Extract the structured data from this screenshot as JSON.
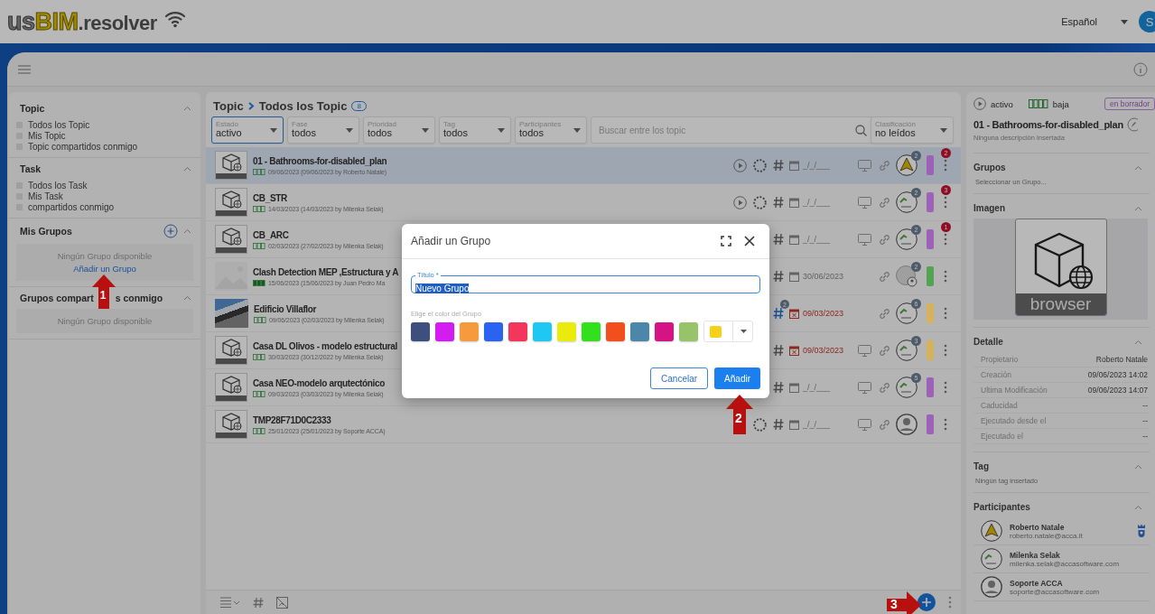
{
  "app": {
    "logo": {
      "prefix": "us",
      "highlight": "BIM",
      "suffix": ".resolver"
    },
    "language": "Español",
    "user_initial": "S"
  },
  "sidebar": {
    "sections": [
      {
        "kind": "list",
        "title": "Topic",
        "items": [
          "Todos los Topic",
          "Mis Topic",
          "Topic compartidos conmigo"
        ]
      },
      {
        "kind": "list",
        "title": "Task",
        "items": [
          "Todos los Task",
          "Mis Task",
          "compartidos conmigo"
        ]
      },
      {
        "kind": "groups",
        "title": "Mis Grupos",
        "empty": "Ningún Grupo disponible",
        "link": "Añadir un Grupo"
      },
      {
        "kind": "shared",
        "title": "Grupos compart",
        "title_end": "s conmigo",
        "empty": "Ningún Grupo disponible"
      }
    ]
  },
  "topics": {
    "breadcrumb": [
      "Topic",
      "Todos los Topic"
    ],
    "count": "8",
    "filters": [
      {
        "label": "Estado",
        "value": "activo",
        "selected": true
      },
      {
        "label": "Fase",
        "value": "todos",
        "selected": false
      },
      {
        "label": "Prioridad",
        "value": "todos",
        "selected": false
      },
      {
        "label": "Tag",
        "value": "todos",
        "selected": false
      },
      {
        "label": "Participantes",
        "value": "todos",
        "selected": false
      }
    ],
    "search": {
      "placeholder": "Buscar entre los topic"
    },
    "sort": {
      "label": "Clasificación",
      "value": "no leídos"
    },
    "rows": [
      {
        "title": "01 - Bathrooms-for-disabled_plan",
        "meta": "09/06/2023 (09/06/2023 by Roberto Natale)",
        "thumb": {
          "kind": "model"
        },
        "high_priority": false,
        "selected": true,
        "play": true,
        "spinner": true,
        "date": "_/_/___",
        "overdue": false,
        "monitor": true,
        "avatar": {
          "kind": "acca",
          "count": "2"
        },
        "color": "#9b62b8",
        "notifications": "2"
      },
      {
        "title": "CB_STR",
        "meta": "14/03/2023 (14/03/2023 by Milenka Selak)",
        "thumb": {
          "kind": "model"
        },
        "high_priority": false,
        "selected": false,
        "play": true,
        "spinner": true,
        "date": "_/_/___",
        "overdue": false,
        "monitor": true,
        "avatar": {
          "kind": "user",
          "count": "2"
        },
        "color": "#9b62b8",
        "notifications": "3"
      },
      {
        "title": "CB_ARC",
        "meta": "02/03/2023 (27/02/2023 by Milenka Selak)",
        "thumb": {
          "kind": "model"
        },
        "high_priority": false,
        "selected": false,
        "play": false,
        "spinner": false,
        "date": "_/_/___",
        "overdue": false,
        "monitor": true,
        "avatar": {
          "kind": "user",
          "count": "2"
        },
        "color": "#9b62b8",
        "notifications": "1"
      },
      {
        "title": "Clash Detection MEP ,Estructura y A",
        "meta": "15/06/2023 (15/06/2023 by Juan Pedro Ma",
        "thumb": {
          "kind": "blank"
        },
        "high_priority": true,
        "selected": false,
        "play": false,
        "spinner": false,
        "date": "30/06/2023",
        "overdue": false,
        "monitor": false,
        "avatar": {
          "kind": "blank",
          "count": "2"
        },
        "color": "#52a352"
      },
      {
        "title": "Edificio Villaflor",
        "meta": "09/06/2023 (02/03/2023 by Milenka Selak)",
        "thumb": {
          "kind": "photo"
        },
        "high_priority": false,
        "selected": false,
        "play": false,
        "spinner": false,
        "tag_count": "2",
        "date": "09/03/2023",
        "overdue": true,
        "monitor": false,
        "avatar": {
          "kind": "user",
          "count": "6"
        },
        "color": "#d4b35c"
      },
      {
        "title": "Casa DL Olivos - modelo estructural",
        "meta": "30/03/2023 (30/12/2022 by Milenka Selak)",
        "thumb": {
          "kind": "model"
        },
        "high_priority": false,
        "selected": false,
        "play": false,
        "spinner": false,
        "date": "09/03/2023",
        "overdue": true,
        "monitor": true,
        "avatar": {
          "kind": "user",
          "count": "3"
        },
        "color": "#d4b35c"
      },
      {
        "title": "Casa NEO-modelo arqutectónico",
        "meta": "09/03/2023 (03/03/2023 by Milenka Selak)",
        "thumb": {
          "kind": "model"
        },
        "high_priority": false,
        "selected": false,
        "play": false,
        "spinner": false,
        "date": "_/_/___",
        "overdue": false,
        "monitor": true,
        "avatar": {
          "kind": "user",
          "count": "5"
        },
        "color": "#9b62b8"
      },
      {
        "title": "TMP28F71D0C2333",
        "meta": "25/01/2023 (25/01/2023 by Soporte ACCA)",
        "thumb": {
          "kind": "model"
        },
        "high_priority": false,
        "selected": false,
        "play": false,
        "spinner": true,
        "date": "_/_/___",
        "overdue": false,
        "monitor": true,
        "avatar": {
          "kind": "generic"
        },
        "color": "#9b62b8"
      }
    ]
  },
  "detail": {
    "status": "activo",
    "priority": "baja",
    "badge": "en borrador",
    "title": "01 - Bathrooms-for-disabled_plan",
    "description": "Ninguna descripción insertada",
    "groups": {
      "title": "Grupos",
      "placeholder": "Seleccionar un Grupo..."
    },
    "image": {
      "title": "Imagen",
      "label": "browser"
    },
    "details": {
      "title": "Detalle",
      "rows": [
        {
          "key": "Propietario",
          "value": "Roberto Natale"
        },
        {
          "key": "Creación",
          "value": "09/06/2023 14:02"
        },
        {
          "key": "Ultima Modificación",
          "value": "09/06/2023 14:07"
        },
        {
          "key": "Caducidad",
          "value": "--"
        },
        {
          "key": "Ejecutado desde el",
          "value": "--"
        },
        {
          "key": "Ejecutado el",
          "value": "--"
        }
      ]
    },
    "tags": {
      "title": "Tag",
      "empty": "Ningún tag insertado"
    },
    "participants": {
      "title": "Participantes",
      "people": [
        {
          "name": "Roberto Natale",
          "email": "roberto.natale@acca.it",
          "avatar": {
            "kind": "acca"
          },
          "owner": true
        },
        {
          "name": "Milenka Selak",
          "email": "milenka.selak@accasoftware.com",
          "avatar": {
            "kind": "user"
          },
          "owner": false
        },
        {
          "name": "Soporte ACCA",
          "email": "soporte@accasoftware.com",
          "avatar": {
            "kind": "generic"
          },
          "owner": false
        }
      ]
    }
  },
  "dialog": {
    "title": "Añadir un Grupo",
    "field": {
      "label": "Título *",
      "value": "Nuevo Grupo",
      "value_selected": true
    },
    "color_label": "Elige el color del Grupo",
    "swatches": [
      {
        "kind": "preset",
        "color": "#3d4f7d"
      },
      {
        "kind": "preset",
        "color": "#d21cf0"
      },
      {
        "kind": "preset",
        "color": "#f79a3e"
      },
      {
        "kind": "preset",
        "color": "#2a63f0"
      },
      {
        "kind": "preset",
        "color": "#f2365c"
      },
      {
        "kind": "preset",
        "color": "#1ec8f3"
      },
      {
        "kind": "preset",
        "color": "#eaea0d"
      },
      {
        "kind": "preset",
        "color": "#33e01e"
      },
      {
        "kind": "preset",
        "color": "#f34f1d"
      },
      {
        "kind": "preset",
        "color": "#4a87a8"
      },
      {
        "kind": "preset",
        "color": "#d41385"
      },
      {
        "kind": "preset",
        "color": "#97c46b"
      },
      {
        "kind": "custom",
        "color": "#f7d117"
      }
    ],
    "buttons": [
      {
        "label": "Cancelar",
        "kind": "secondary"
      },
      {
        "label": "Añadir",
        "kind": "primary"
      }
    ]
  },
  "callouts": [
    {
      "label": "1"
    },
    {
      "label": "2"
    },
    {
      "label": "3"
    }
  ]
}
